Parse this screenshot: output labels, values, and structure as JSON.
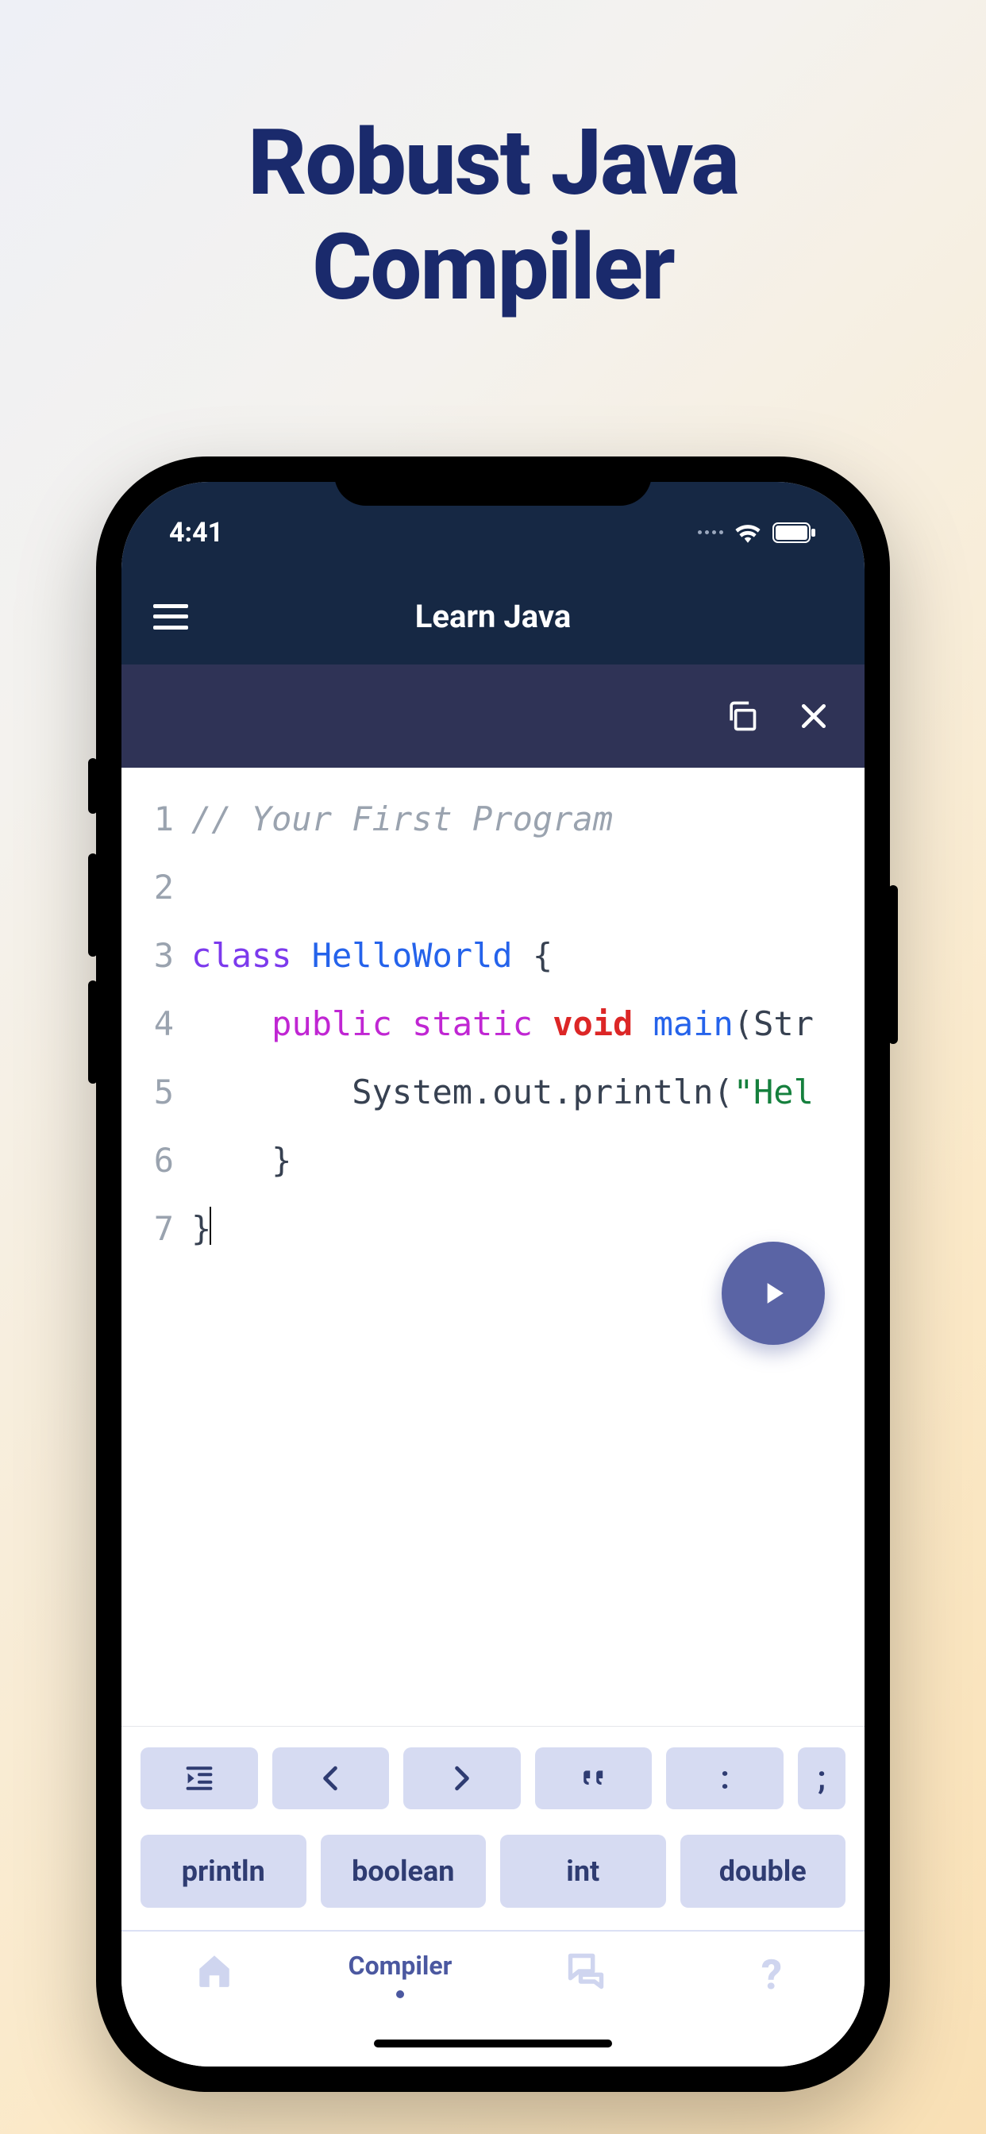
{
  "headline_line1": "Robust Java",
  "headline_line2": "Compiler",
  "status": {
    "time": "4:41"
  },
  "header": {
    "title": "Learn Java"
  },
  "icons": {
    "menu": "menu-icon",
    "copy": "copy-icon",
    "close": "close-icon",
    "wifi": "wifi-icon",
    "battery": "battery-icon",
    "run": "play-icon",
    "home": "home-icon",
    "chat": "chat-icon",
    "help": "question-icon",
    "chev_left": "chevron-left-icon",
    "chev_right": "chevron-right-icon",
    "quote": "quote-icon",
    "indent": "indent-icon"
  },
  "code": {
    "comment": "// Your First Program",
    "kw_class": "class",
    "cls_name": "HelloWorld",
    "brace_open": " {",
    "kw_public": "public",
    "kw_static": "static",
    "kw_void": "void",
    "fn_main": "main",
    "paren_str": "(Str",
    "sys_call": "System.out.println(",
    "str_lit": "\"Hel",
    "brace_close_in": "    }",
    "brace_close_out": "}",
    "linenos": [
      "1",
      "2",
      "3",
      "4",
      "5",
      "6",
      "7"
    ]
  },
  "symbol_row": {
    "colon": ":",
    "semicolon": ";"
  },
  "word_row": [
    "println",
    "boolean",
    "int",
    "double"
  ],
  "bottom_nav": {
    "compiler": "Compiler",
    "help": "?"
  }
}
